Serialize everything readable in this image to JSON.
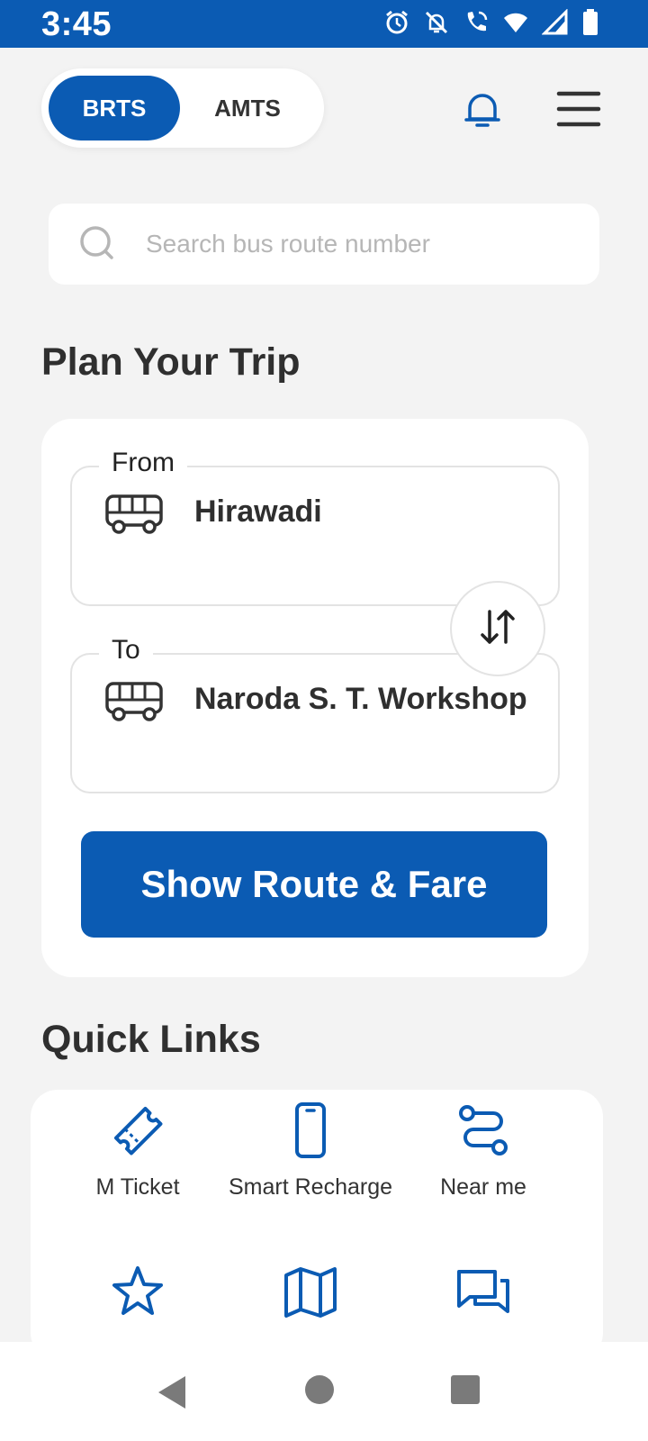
{
  "status_bar": {
    "time": "3:45",
    "icons": [
      "alarm-icon",
      "notifications-off-icon",
      "wifi-calling-icon",
      "wifi-icon",
      "signal-icon",
      "battery-icon"
    ]
  },
  "header": {
    "toggle": {
      "active": "BRTS",
      "inactive": "AMTS"
    },
    "icons": [
      "bell-icon",
      "hamburger-menu-icon"
    ]
  },
  "search": {
    "placeholder": "Search bus route number",
    "value": ""
  },
  "plan_trip": {
    "title": "Plan Your Trip",
    "from_label": "From",
    "from_value": "Hirawadi",
    "to_label": "To",
    "to_value": "Naroda S. T. Workshop",
    "cta_label": "Show Route & Fare"
  },
  "quick_links": {
    "title": "Quick Links",
    "items": [
      {
        "label": "M Ticket",
        "icon": "ticket-icon"
      },
      {
        "label": "Smart Recharge",
        "icon": "smart-card-icon"
      },
      {
        "label": "Near me",
        "icon": "route-icon"
      },
      {
        "label": "",
        "icon": "star-icon"
      },
      {
        "label": "",
        "icon": "map-icon"
      },
      {
        "label": "",
        "icon": "chat-icon"
      }
    ]
  },
  "nav_bar": {
    "icons": [
      "back-icon",
      "home-icon",
      "recents-icon"
    ]
  },
  "colors": {
    "primary": "#0b5bb3",
    "background": "#f3f3f3",
    "card": "#ffffff",
    "text": "#2f2f2f",
    "placeholder": "#b6b6b6"
  }
}
